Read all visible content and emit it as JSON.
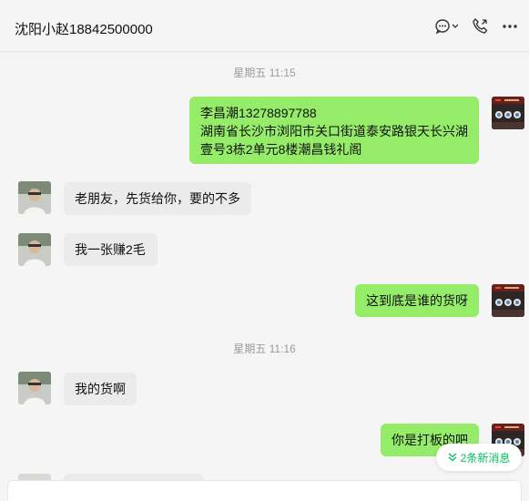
{
  "header": {
    "title": "沈阳小赵18842500000"
  },
  "timestamps": [
    "星期五 11:15",
    "星期五 11:16"
  ],
  "messages": [
    {
      "from": "me",
      "text": "李昌潮13278897788\n湖南省长沙市浏阳市关口街道泰安路银天长兴湖\n壹号3栋2单元8楼潮昌钱礼阁"
    },
    {
      "from": "peer",
      "text": "老朋友，先货给你，要的不多"
    },
    {
      "from": "peer",
      "text": "我一张赚2毛"
    },
    {
      "from": "me",
      "text": "这到底是谁的货呀"
    },
    {
      "from": "peer",
      "text": "我的货啊"
    },
    {
      "from": "me",
      "text": "你是打板的吧"
    }
  ],
  "new_messages": {
    "label": "2条新消息"
  },
  "colors": {
    "my_bubble": "#95ec69",
    "peer_bubble": "#ebebeb",
    "new_msg_text": "#07c160"
  }
}
